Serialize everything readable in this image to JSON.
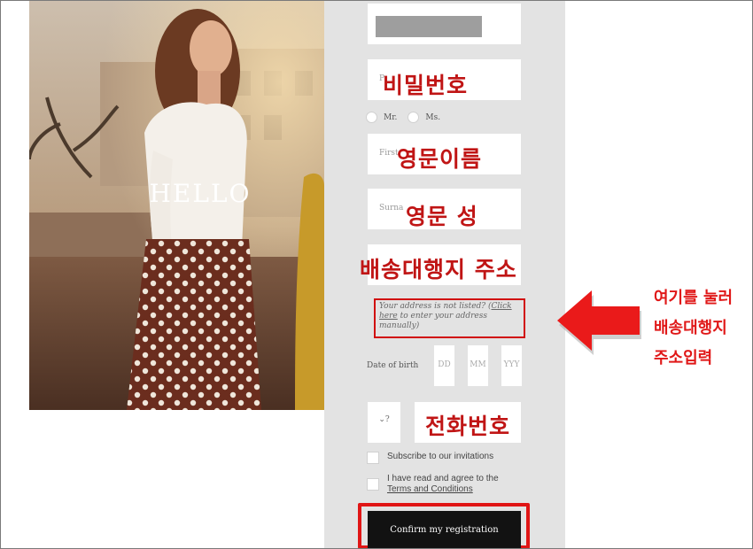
{
  "hero": {
    "greeting": "HELLO"
  },
  "form": {
    "password": {
      "placeholder": "P",
      "annotation": "비밀번호"
    },
    "title_radio": {
      "options": [
        "Mr.",
        "Ms."
      ]
    },
    "first_name": {
      "placeholder": "First",
      "annotation": "영문이름"
    },
    "surname": {
      "placeholder": "Surna",
      "annotation": "영문 성"
    },
    "address": {
      "annotation": "배송대행지 주소"
    },
    "manual_address": {
      "prefix": "Your address is not listed? (",
      "link": "Click here",
      "suffix": " to enter your address manually)"
    },
    "date_of_birth": {
      "label": "Date of birth",
      "day": "DD",
      "month": "MM",
      "year": "YYY"
    },
    "phone": {
      "code": "?",
      "annotation": "전화번호"
    },
    "subscribe": {
      "label": "Subscribe to our invitations"
    },
    "terms": {
      "prefix": "I have read and agree to the",
      "link": "Terms and Conditions"
    },
    "confirm_button": "Confirm my registration"
  },
  "annotation_note": {
    "lines": [
      "여기를 눌러",
      "배송대행지",
      "주소입력"
    ]
  },
  "colors": {
    "panel_bg": "#e3e3e3",
    "highlight_red": "#e01515",
    "button_bg": "#121212"
  }
}
